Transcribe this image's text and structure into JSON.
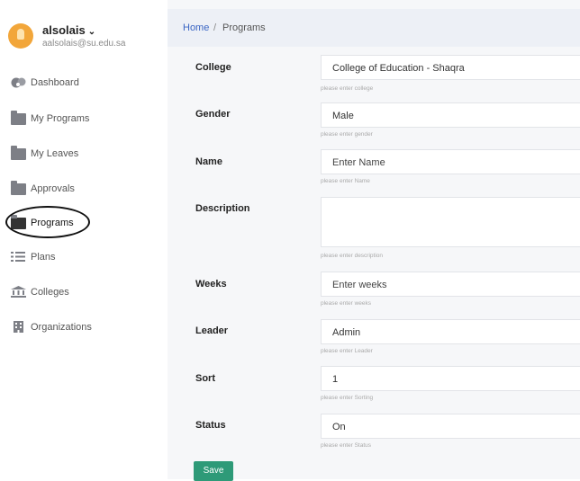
{
  "user": {
    "name": "alsolais",
    "email": "aalsolais@su.edu.sa"
  },
  "sidebar": {
    "items": [
      {
        "label": "Dashboard",
        "icon": "dashboard-icon"
      },
      {
        "label": "My Programs",
        "icon": "folder-icon"
      },
      {
        "label": "My Leaves",
        "icon": "folder-icon"
      },
      {
        "label": "Approvals",
        "icon": "folder-icon"
      },
      {
        "label": "Programs",
        "icon": "folder-icon",
        "active": true
      },
      {
        "label": "Plans",
        "icon": "list-icon"
      },
      {
        "label": "Colleges",
        "icon": "bank-icon"
      },
      {
        "label": "Organizations",
        "icon": "building-icon"
      }
    ]
  },
  "breadcrumb": {
    "home": "Home",
    "separator": "/",
    "current": "Programs"
  },
  "form": {
    "college": {
      "label": "College",
      "value": "College of Education - Shaqra",
      "hint": "please enter college"
    },
    "gender": {
      "label": "Gender",
      "value": "Male",
      "hint": "please enter gender"
    },
    "name": {
      "label": "Name",
      "placeholder": "Enter Name",
      "hint": "please enter Name"
    },
    "description": {
      "label": "Description",
      "value": "",
      "hint": "please enter description"
    },
    "weeks": {
      "label": "Weeks",
      "placeholder": "Enter weeks",
      "hint": "please enter weeks"
    },
    "leader": {
      "label": "Leader",
      "value": "Admin",
      "hint": "please enter Leader"
    },
    "sort": {
      "label": "Sort",
      "value": "1",
      "hint": "please enter Sorting"
    },
    "status": {
      "label": "Status",
      "value": "On",
      "hint": "please enter Status"
    },
    "save_label": "Save"
  },
  "colors": {
    "accent": "#2e9a78",
    "link": "#3b66c4",
    "avatar": "#f2a63a"
  }
}
